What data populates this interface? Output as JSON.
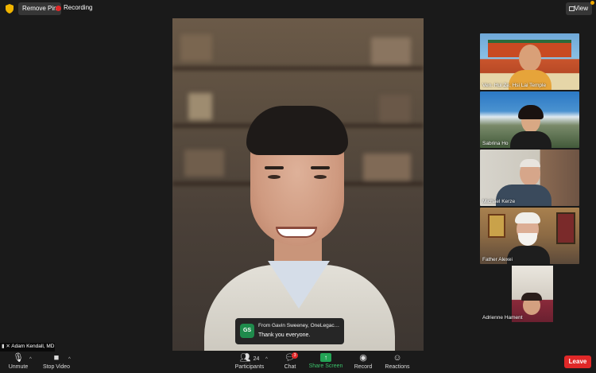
{
  "topbar": {
    "remove_pin_label": "Remove Pin",
    "recording_label": "Recording",
    "view_label": "View"
  },
  "chat_notice": {
    "initials": "GS",
    "from": "From Gavin Sweeney, OneLegacy t...",
    "message": "Thank you everyone."
  },
  "participants": [
    {
      "name": "Ven. Hui Ze, Hsi Lai Temple"
    },
    {
      "name": "Sabrina Ho"
    },
    {
      "name": "Michael Kerze"
    },
    {
      "name": "Father Alexei"
    },
    {
      "name": "Adrienne Hament"
    }
  ],
  "self_name": "Adam Kendall, MD",
  "toolbar": {
    "unmute": "Unmute",
    "stop_video": "Stop Video",
    "participants": "Participants",
    "participant_count": "24",
    "chat": "Chat",
    "chat_badge": "3",
    "share_screen": "Share Screen",
    "record": "Record",
    "reactions": "Reactions",
    "leave": "Leave"
  },
  "colors": {
    "background": "#1a1a1a",
    "leave_red": "#e02828",
    "share_green": "#23a455"
  }
}
